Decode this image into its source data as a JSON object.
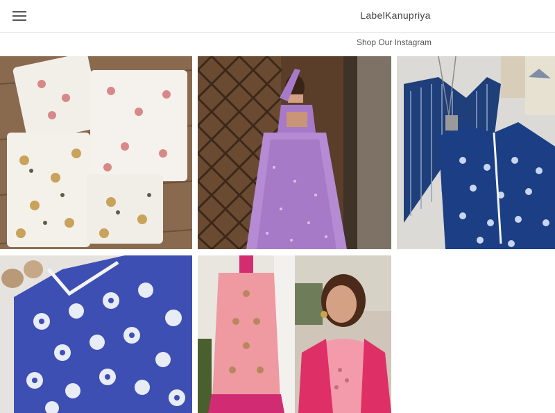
{
  "header": {
    "brand": "LabelKanupriya",
    "menu_icon": "hamburger-menu-icon"
  },
  "subnav": {
    "link": "Shop Our Instagram"
  },
  "gallery": {
    "tiles": [
      {
        "name": "white-floral-kurta-sets-photo"
      },
      {
        "name": "lavender-lehenga-model-photo"
      },
      {
        "name": "indigo-printed-kurta-photo"
      },
      {
        "name": "blue-floral-dress-photo"
      },
      {
        "name": "pink-embroidered-kurta-photo"
      }
    ]
  }
}
